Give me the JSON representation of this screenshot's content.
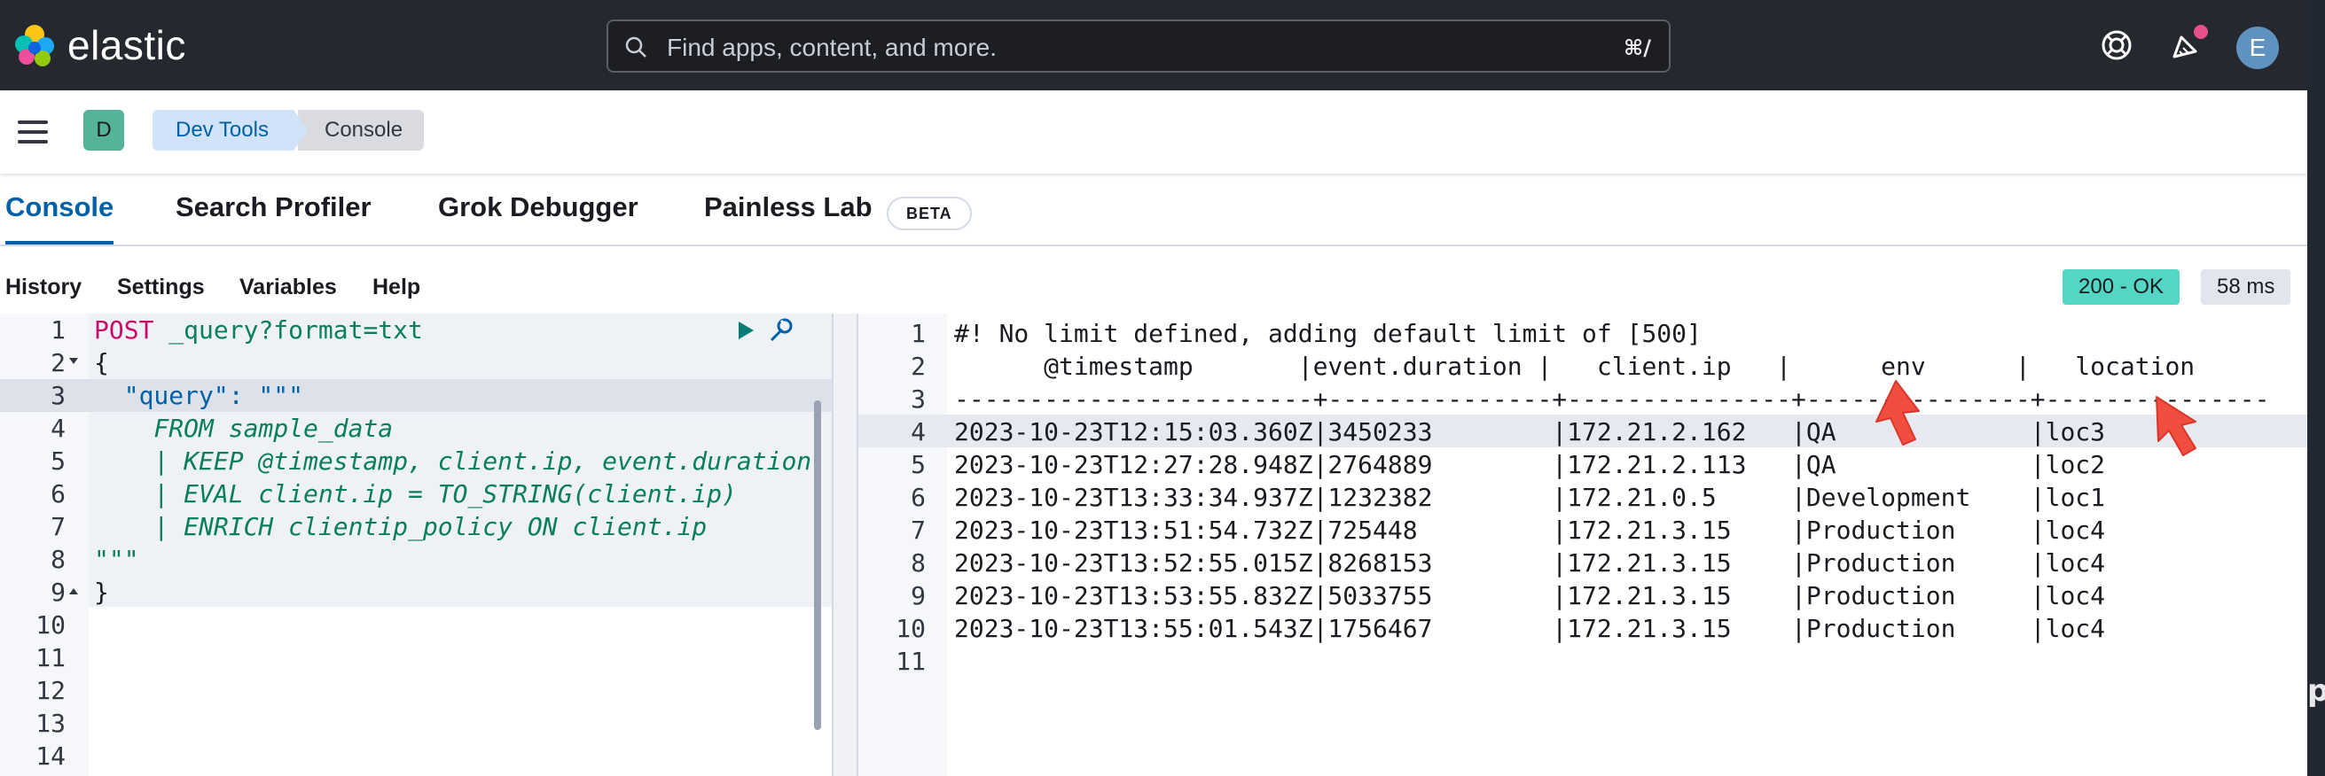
{
  "header": {
    "brand": "elastic",
    "search_placeholder": "Find apps, content, and more.",
    "search_shortcut": "⌘/",
    "avatar_initial": "E"
  },
  "breadcrumb": {
    "space_initial": "D",
    "items": [
      "Dev Tools",
      "Console"
    ]
  },
  "tabs": [
    {
      "label": "Console",
      "active": true
    },
    {
      "label": "Search Profiler"
    },
    {
      "label": "Grok Debugger"
    },
    {
      "label": "Painless Lab"
    }
  ],
  "beta_badge": "BETA",
  "toolbar": {
    "links": [
      "History",
      "Settings",
      "Variables",
      "Help"
    ],
    "status": "200 - OK",
    "time": "58 ms"
  },
  "request": {
    "line_numbers": [
      "1",
      "2",
      "3",
      "4",
      "5",
      "6",
      "7",
      "8",
      "9",
      "10",
      "11",
      "12",
      "13",
      "14"
    ],
    "method": "POST",
    "path": "_query?format=txt",
    "lines": [
      "{",
      "  \"query\": \"\"\"",
      "    FROM sample_data",
      "    | KEEP @timestamp, client.ip, event.duration",
      "    | EVAL client.ip = TO_STRING(client.ip)",
      "    | ENRICH clientip_policy ON client.ip",
      "\"\"\"",
      "}"
    ]
  },
  "response": {
    "line_numbers": [
      "1",
      "2",
      "3",
      "4",
      "5",
      "6",
      "7",
      "8",
      "9",
      "10",
      "11"
    ],
    "lines": [
      "#! No limit defined, adding default limit of [500]",
      "      @timestamp       |event.duration |   client.ip   |      env      |   location    ",
      "------------------------+---------------+---------------+---------------+---------------",
      "2023-10-23T12:15:03.360Z|3450233        |172.21.2.162   |QA             |loc3           ",
      "2023-10-23T12:27:28.948Z|2764889        |172.21.2.113   |QA             |loc2           ",
      "2023-10-23T13:33:34.937Z|1232382        |172.21.0.5     |Development    |loc1           ",
      "2023-10-23T13:51:54.732Z|725448         |172.21.3.15    |Production     |loc4           ",
      "2023-10-23T13:52:55.015Z|8268153        |172.21.3.15    |Production     |loc4           ",
      "2023-10-23T13:53:55.832Z|5033755        |172.21.3.15    |Production     |loc4           ",
      "2023-10-23T13:55:01.543Z|1756467        |172.21.3.15    |Production     |loc4           ",
      ""
    ]
  },
  "side_glyph": "p"
}
